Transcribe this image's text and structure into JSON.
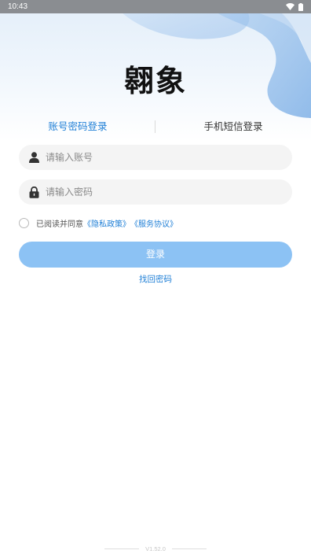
{
  "status_bar": {
    "time": "10:43",
    "wifi_icon": "wifi-icon",
    "battery_icon": "battery-icon"
  },
  "app": {
    "logo_text": "翱象"
  },
  "tabs": [
    {
      "label": "账号密码登录",
      "active": true
    },
    {
      "label": "手机短信登录",
      "active": false
    }
  ],
  "form": {
    "account_placeholder": "请输入账号",
    "account_value": "",
    "account_icon": "user-icon",
    "password_placeholder": "请输入密码",
    "password_value": "",
    "password_icon": "lock-icon"
  },
  "agreement": {
    "prefix": "已阅读并同意",
    "privacy_link": "《隐私政策》",
    "service_link": "《服务协议》",
    "checked": false
  },
  "actions": {
    "login_label": "登录",
    "forgot_label": "找回密码"
  },
  "footer": {
    "version": "V1.52.0"
  },
  "colors": {
    "accent": "#1f7fd6",
    "login_button": "#8cc2f4",
    "input_bg": "#f4f4f4"
  }
}
